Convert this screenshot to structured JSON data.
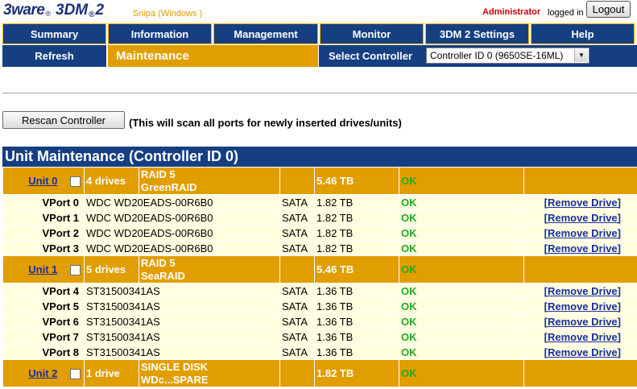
{
  "header": {
    "logo_brand": "3ware",
    "logo_reg": "®",
    "logo_product": "3DM",
    "logo_reg2": "®",
    "logo_version": "2",
    "host": "Snipa (Windows )",
    "user": "Administrator",
    "logged_in_text": "logged in",
    "logout_label": "Logout"
  },
  "nav": {
    "row1": [
      "Summary",
      "Information",
      "Management",
      "Monitor",
      "3DM 2 Settings",
      "Help"
    ],
    "refresh_label": "Refresh",
    "current_page": "Maintenance",
    "select_controller_label": "Select Controller",
    "controller_selected": "Controller ID 0 (9650SE-16ML)"
  },
  "rescan": {
    "button_label": "Rescan Controller",
    "note": "(This will scan all ports for newly inserted drives/units)"
  },
  "unit_maintenance": {
    "title": "Unit Maintenance (Controller ID 0)",
    "units": [
      {
        "label": "Unit 0",
        "drives": "4 drives",
        "raid": "RAID 5",
        "name": "GreenRAID",
        "size": "5.46 TB",
        "status": "OK",
        "ports": [
          {
            "port": "VPort 0",
            "model": "WDC WD20EADS-00R6B0",
            "iface": "SATA",
            "size": "1.82 TB",
            "status": "OK",
            "action": "[Remove Drive]"
          },
          {
            "port": "VPort 1",
            "model": "WDC WD20EADS-00R6B0",
            "iface": "SATA",
            "size": "1.82 TB",
            "status": "OK",
            "action": "[Remove Drive]"
          },
          {
            "port": "VPort 2",
            "model": "WDC WD20EADS-00R6B0",
            "iface": "SATA",
            "size": "1.82 TB",
            "status": "OK",
            "action": "[Remove Drive]"
          },
          {
            "port": "VPort 3",
            "model": "WDC WD20EADS-00R6B0",
            "iface": "SATA",
            "size": "1.82 TB",
            "status": "OK",
            "action": "[Remove Drive]"
          }
        ]
      },
      {
        "label": "Unit 1",
        "drives": "5 drives",
        "raid": "RAID 5",
        "name": "SeaRAID",
        "size": "5.46 TB",
        "status": "OK",
        "ports": [
          {
            "port": "VPort 4",
            "model": "ST31500341AS",
            "iface": "SATA",
            "size": "1.36 TB",
            "status": "OK",
            "action": "[Remove Drive]"
          },
          {
            "port": "VPort 5",
            "model": "ST31500341AS",
            "iface": "SATA",
            "size": "1.36 TB",
            "status": "OK",
            "action": "[Remove Drive]"
          },
          {
            "port": "VPort 6",
            "model": "ST31500341AS",
            "iface": "SATA",
            "size": "1.36 TB",
            "status": "OK",
            "action": "[Remove Drive]"
          },
          {
            "port": "VPort 7",
            "model": "ST31500341AS",
            "iface": "SATA",
            "size": "1.36 TB",
            "status": "OK",
            "action": "[Remove Drive]"
          },
          {
            "port": "VPort 8",
            "model": "ST31500341AS",
            "iface": "SATA",
            "size": "1.36 TB",
            "status": "OK",
            "action": "[Remove Drive]"
          }
        ]
      },
      {
        "label": "Unit 2",
        "drives": "1 drive",
        "raid": "SINGLE DISK",
        "name": "WDc...SPARE",
        "size": "1.82 TB",
        "status": "OK",
        "ports": []
      }
    ]
  }
}
